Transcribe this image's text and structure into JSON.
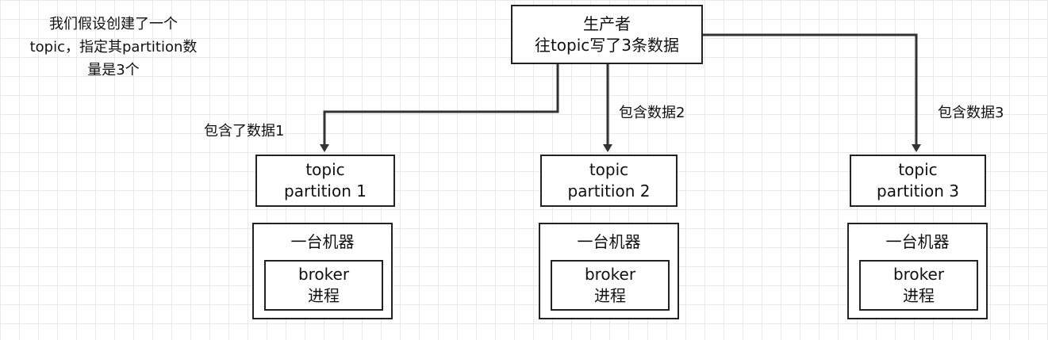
{
  "note": {
    "line1": "我们假设创建了一个",
    "line2": "topic，指定其partition数",
    "line3": "量是3个"
  },
  "producer": {
    "line1": "生产者",
    "line2": "往topic写了3条数据"
  },
  "edges": [
    {
      "label": "包含了数据1"
    },
    {
      "label": "包含数据2"
    },
    {
      "label": "包含数据3"
    }
  ],
  "partitions": [
    {
      "line1": "topic",
      "line2": "partition 1",
      "machine": "一台机器",
      "broker1": "broker",
      "broker2": "进程"
    },
    {
      "line1": "topic",
      "line2": "partition 2",
      "machine": "一台机器",
      "broker1": "broker",
      "broker2": "进程"
    },
    {
      "line1": "topic",
      "line2": "partition 3",
      "machine": "一台机器",
      "broker1": "broker",
      "broker2": "进程"
    }
  ]
}
